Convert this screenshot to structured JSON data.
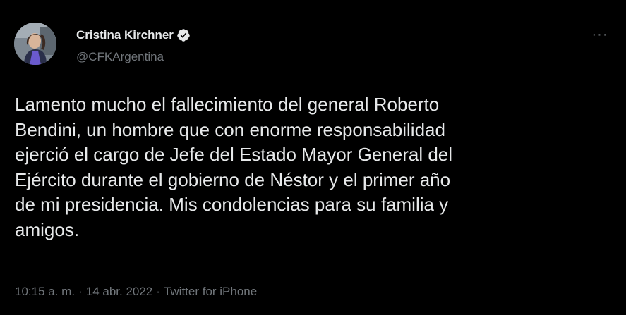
{
  "author": {
    "name": "Cristina Kirchner",
    "handle": "@CFKArgentina",
    "verified": true,
    "avatar_icon": "profile-photo"
  },
  "tweet": {
    "text": "Lamento mucho el fallecimiento del general Roberto\nBendini, un hombre que con enorme responsabilidad\nejerció el cargo de Jefe del Estado Mayor General del\nEjército durante el gobierno de Néstor y el primer año\nde mi presidencia. Mis condolencias para su familia y\namigos.",
    "time": "10:15 a. m.",
    "date": "14 abr. 2022",
    "separator": "·",
    "source": "Twitter for iPhone"
  },
  "menu": {
    "more_label": "···",
    "icon": "more-horizontal-icon"
  },
  "colors": {
    "background": "#000000",
    "text_primary": "#e7e9ea",
    "text_secondary": "#71767b",
    "verified_badge": "#e7e9ea"
  }
}
